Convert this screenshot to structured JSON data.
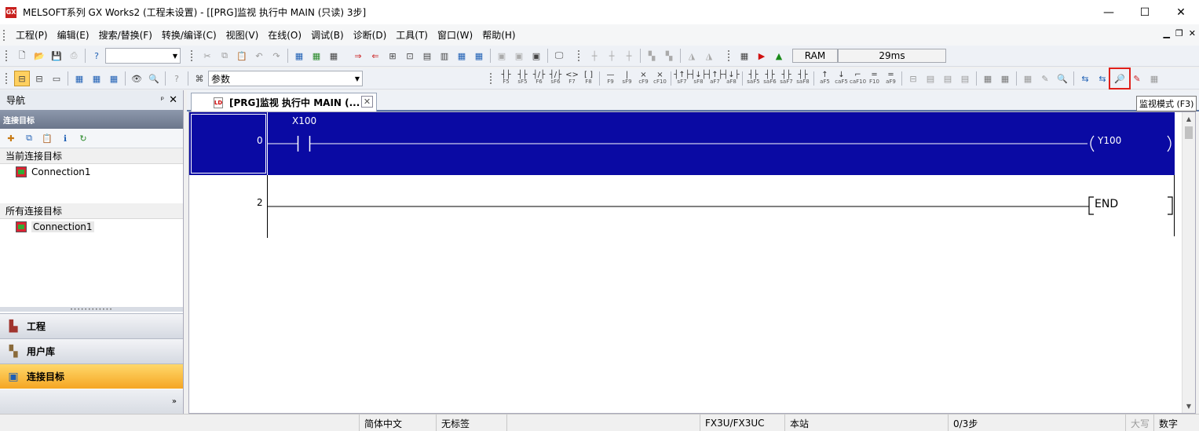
{
  "window": {
    "title": "MELSOFT系列 GX Works2 (工程未设置) - [[PRG]监视 执行中 MAIN (只读) 3步]",
    "app_icon": "GX",
    "buttons": [
      "—",
      "☐",
      "✕"
    ]
  },
  "menu": {
    "items": [
      "工程(P)",
      "编辑(E)",
      "搜索/替换(F)",
      "转换/编译(C)",
      "视图(V)",
      "在线(O)",
      "调试(B)",
      "诊断(D)",
      "工具(T)",
      "窗口(W)",
      "帮助(H)"
    ],
    "mdi_buttons": [
      "▁",
      "❐",
      "✕"
    ]
  },
  "toolbar1": {
    "combo_value": "",
    "status_mode": "RAM",
    "status_scan": "29ms"
  },
  "toolbar2": {
    "search_combo": "参数"
  },
  "ladder_toolbar": {
    "items": [
      {
        "top": "┤├",
        "bottom": "F5"
      },
      {
        "top": "┤├",
        "bottom": "sF5"
      },
      {
        "top": "┤/├",
        "bottom": "F6"
      },
      {
        "top": "┤/├",
        "bottom": "sF6"
      },
      {
        "top": "<>",
        "bottom": "F7"
      },
      {
        "top": "[ ]",
        "bottom": "F8"
      },
      {
        "top": "—",
        "bottom": "F9"
      },
      {
        "top": "|",
        "bottom": "sF9"
      },
      {
        "top": "×",
        "bottom": "cF9"
      },
      {
        "top": "×",
        "bottom": "cF10"
      },
      {
        "top": "┤↑├",
        "bottom": "sF7"
      },
      {
        "top": "┤↓├",
        "bottom": "sF8"
      },
      {
        "top": "┤↑├",
        "bottom": "aF7"
      },
      {
        "top": "┤↓├",
        "bottom": "aF8"
      },
      {
        "top": "┤├",
        "bottom": "saF5"
      },
      {
        "top": "┤├",
        "bottom": "saF6"
      },
      {
        "top": "┤├",
        "bottom": "saF7"
      },
      {
        "top": "┤├",
        "bottom": "saF8"
      },
      {
        "top": "↑",
        "bottom": "aF5"
      },
      {
        "top": "↓",
        "bottom": "caF5"
      },
      {
        "top": "⌐",
        "bottom": "caF10"
      },
      {
        "top": "═",
        "bottom": "F10"
      },
      {
        "top": "═",
        "bottom": "aF9"
      }
    ],
    "monitor_mode_icon": "monitor-mode-icon"
  },
  "tooltip": {
    "text": "监视模式 (F3)"
  },
  "navigation": {
    "title": "导航",
    "pin": "ᵖ",
    "close": "✕",
    "section_title": "连接目标",
    "current_label": "当前连接目标",
    "current_items": [
      "Connection1"
    ],
    "all_label": "所有连接目标",
    "all_items": [
      "Connection1"
    ],
    "panels": [
      {
        "label": "工程",
        "icon": "project-icon",
        "active": false
      },
      {
        "label": "用户库",
        "icon": "user-library-icon",
        "active": false
      },
      {
        "label": "连接目标",
        "icon": "connection-destination-icon",
        "active": true
      }
    ],
    "expand": "»"
  },
  "document_tab": {
    "label": "[PRG]监视 执行中 MAIN (...",
    "close": "✕"
  },
  "ladder": {
    "rungs": [
      {
        "step": "0",
        "contact": "X100",
        "coil": "Y100",
        "selected": true
      },
      {
        "step": "2",
        "instruction": "END",
        "selected": false
      }
    ]
  },
  "statusbar": {
    "language": "简体中文",
    "label": "无标签",
    "plc_type": "FX3U/FX3UC",
    "station": "本站",
    "steps": "0/3步",
    "caps": "大写",
    "num": "数字"
  },
  "colors": {
    "selected_rung": "#0a0aa3",
    "highlight_box": "#e0201a",
    "active_panel": "#f5a623"
  }
}
